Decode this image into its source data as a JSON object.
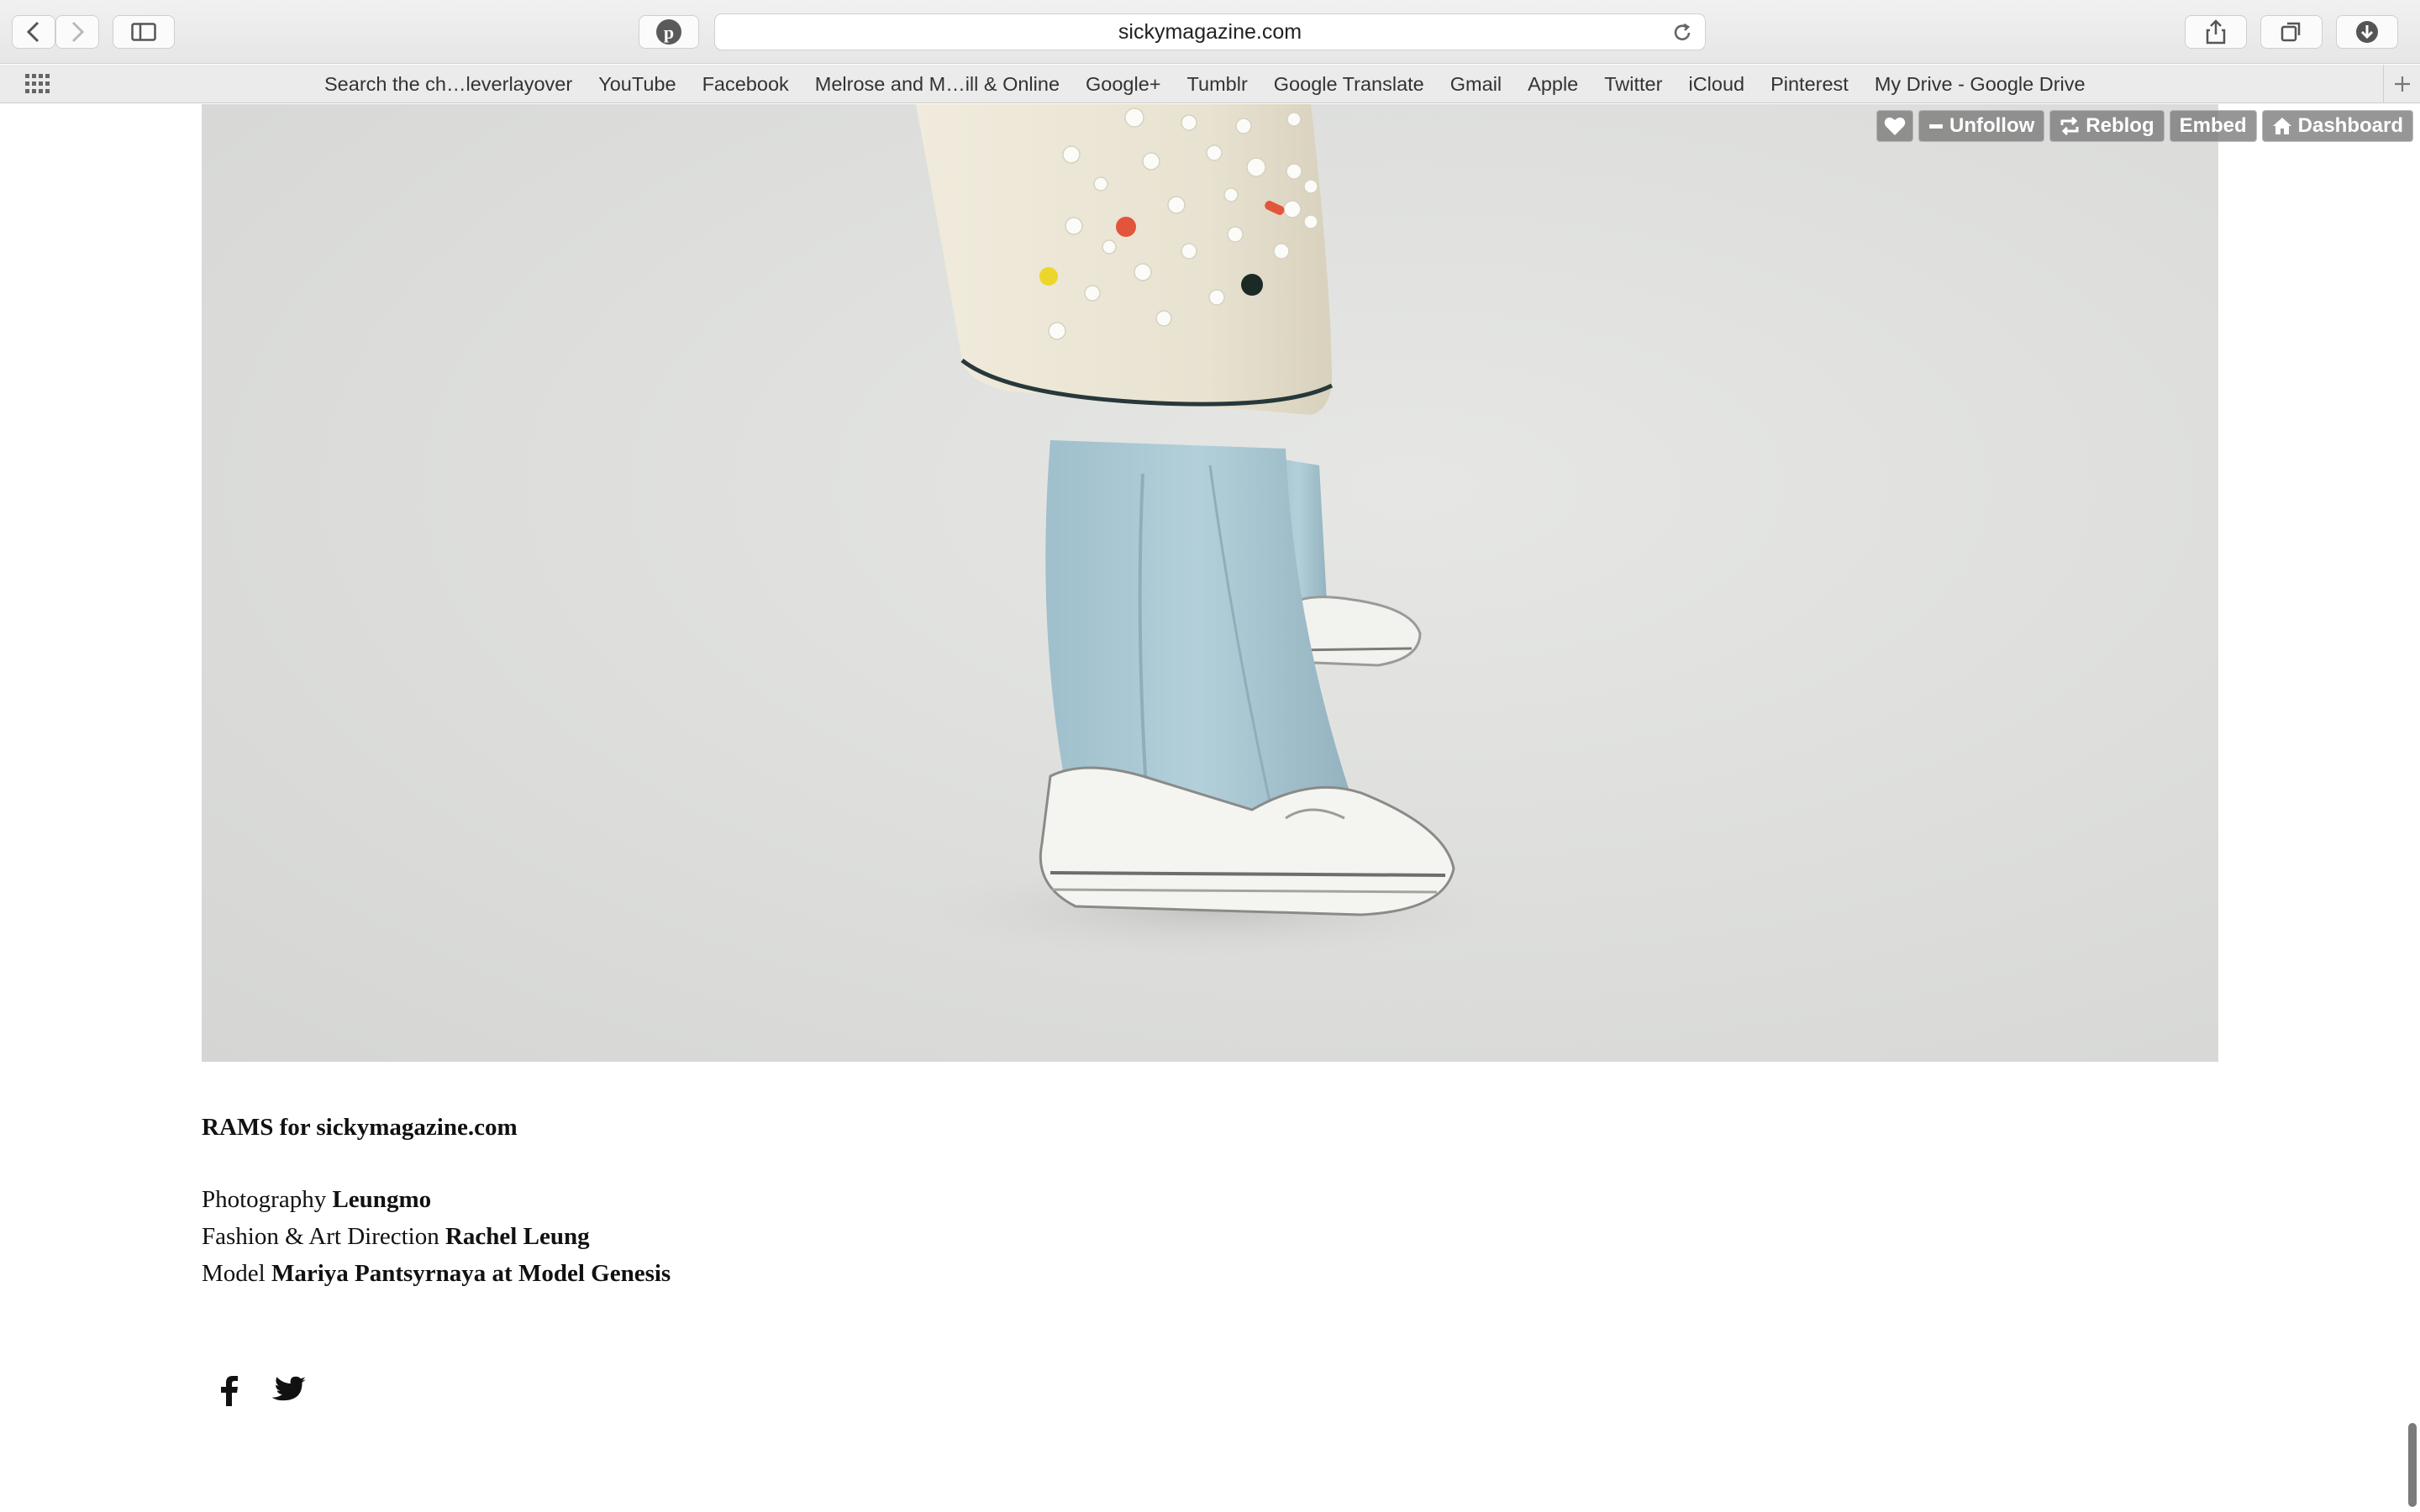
{
  "browser": {
    "url": "sickymagazine.com",
    "bookmarks": [
      "Search the ch…leverlayover",
      "YouTube",
      "Facebook",
      "Melrose and M…ill & Online",
      "Google+",
      "Tumblr",
      "Google Translate",
      "Gmail",
      "Apple",
      "Twitter",
      "iCloud",
      "Pinterest",
      "My Drive - Google Drive"
    ]
  },
  "tumblr_controls": {
    "unfollow": "Unfollow",
    "reblog": "Reblog",
    "embed": "Embed",
    "dashboard": "Dashboard"
  },
  "post": {
    "title": "RAMS for sickymagazine.com",
    "credits": [
      {
        "role": "Photography",
        "name": "Leungmo"
      },
      {
        "role": "Fashion & Art Direction",
        "name": "Rachel Leung"
      },
      {
        "role": "Model",
        "name": "Mariya Pantsyrnaya at Model Genesis"
      }
    ]
  },
  "colors": {
    "skirt": "#ece7d8",
    "trousers": "#a9c7d2",
    "dot_red": "#e2553a",
    "dot_yellow": "#ecd62c",
    "dot_black": "#1c2a26"
  },
  "icons": [
    "back-icon",
    "forward-icon",
    "sidebar-icon",
    "pinterest-icon",
    "reload-icon",
    "share-icon",
    "tabs-icon",
    "download-icon",
    "apps-grid-icon",
    "plus-icon",
    "heart-icon",
    "minus-icon",
    "reblog-icon",
    "home-icon",
    "facebook-icon",
    "twitter-icon"
  ]
}
